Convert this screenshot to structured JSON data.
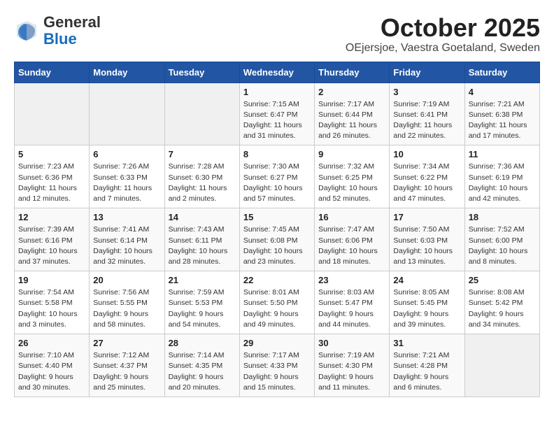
{
  "header": {
    "logo_general": "General",
    "logo_blue": "Blue",
    "month": "October 2025",
    "location": "OEjersjoe, Vaestra Goetaland, Sweden"
  },
  "days_of_week": [
    "Sunday",
    "Monday",
    "Tuesday",
    "Wednesday",
    "Thursday",
    "Friday",
    "Saturday"
  ],
  "weeks": [
    [
      {
        "day": "",
        "info": ""
      },
      {
        "day": "",
        "info": ""
      },
      {
        "day": "",
        "info": ""
      },
      {
        "day": "1",
        "info": "Sunrise: 7:15 AM\nSunset: 6:47 PM\nDaylight: 11 hours\nand 31 minutes."
      },
      {
        "day": "2",
        "info": "Sunrise: 7:17 AM\nSunset: 6:44 PM\nDaylight: 11 hours\nand 26 minutes."
      },
      {
        "day": "3",
        "info": "Sunrise: 7:19 AM\nSunset: 6:41 PM\nDaylight: 11 hours\nand 22 minutes."
      },
      {
        "day": "4",
        "info": "Sunrise: 7:21 AM\nSunset: 6:38 PM\nDaylight: 11 hours\nand 17 minutes."
      }
    ],
    [
      {
        "day": "5",
        "info": "Sunrise: 7:23 AM\nSunset: 6:36 PM\nDaylight: 11 hours\nand 12 minutes."
      },
      {
        "day": "6",
        "info": "Sunrise: 7:26 AM\nSunset: 6:33 PM\nDaylight: 11 hours\nand 7 minutes."
      },
      {
        "day": "7",
        "info": "Sunrise: 7:28 AM\nSunset: 6:30 PM\nDaylight: 11 hours\nand 2 minutes."
      },
      {
        "day": "8",
        "info": "Sunrise: 7:30 AM\nSunset: 6:27 PM\nDaylight: 10 hours\nand 57 minutes."
      },
      {
        "day": "9",
        "info": "Sunrise: 7:32 AM\nSunset: 6:25 PM\nDaylight: 10 hours\nand 52 minutes."
      },
      {
        "day": "10",
        "info": "Sunrise: 7:34 AM\nSunset: 6:22 PM\nDaylight: 10 hours\nand 47 minutes."
      },
      {
        "day": "11",
        "info": "Sunrise: 7:36 AM\nSunset: 6:19 PM\nDaylight: 10 hours\nand 42 minutes."
      }
    ],
    [
      {
        "day": "12",
        "info": "Sunrise: 7:39 AM\nSunset: 6:16 PM\nDaylight: 10 hours\nand 37 minutes."
      },
      {
        "day": "13",
        "info": "Sunrise: 7:41 AM\nSunset: 6:14 PM\nDaylight: 10 hours\nand 32 minutes."
      },
      {
        "day": "14",
        "info": "Sunrise: 7:43 AM\nSunset: 6:11 PM\nDaylight: 10 hours\nand 28 minutes."
      },
      {
        "day": "15",
        "info": "Sunrise: 7:45 AM\nSunset: 6:08 PM\nDaylight: 10 hours\nand 23 minutes."
      },
      {
        "day": "16",
        "info": "Sunrise: 7:47 AM\nSunset: 6:06 PM\nDaylight: 10 hours\nand 18 minutes."
      },
      {
        "day": "17",
        "info": "Sunrise: 7:50 AM\nSunset: 6:03 PM\nDaylight: 10 hours\nand 13 minutes."
      },
      {
        "day": "18",
        "info": "Sunrise: 7:52 AM\nSunset: 6:00 PM\nDaylight: 10 hours\nand 8 minutes."
      }
    ],
    [
      {
        "day": "19",
        "info": "Sunrise: 7:54 AM\nSunset: 5:58 PM\nDaylight: 10 hours\nand 3 minutes."
      },
      {
        "day": "20",
        "info": "Sunrise: 7:56 AM\nSunset: 5:55 PM\nDaylight: 9 hours\nand 58 minutes."
      },
      {
        "day": "21",
        "info": "Sunrise: 7:59 AM\nSunset: 5:53 PM\nDaylight: 9 hours\nand 54 minutes."
      },
      {
        "day": "22",
        "info": "Sunrise: 8:01 AM\nSunset: 5:50 PM\nDaylight: 9 hours\nand 49 minutes."
      },
      {
        "day": "23",
        "info": "Sunrise: 8:03 AM\nSunset: 5:47 PM\nDaylight: 9 hours\nand 44 minutes."
      },
      {
        "day": "24",
        "info": "Sunrise: 8:05 AM\nSunset: 5:45 PM\nDaylight: 9 hours\nand 39 minutes."
      },
      {
        "day": "25",
        "info": "Sunrise: 8:08 AM\nSunset: 5:42 PM\nDaylight: 9 hours\nand 34 minutes."
      }
    ],
    [
      {
        "day": "26",
        "info": "Sunrise: 7:10 AM\nSunset: 4:40 PM\nDaylight: 9 hours\nand 30 minutes."
      },
      {
        "day": "27",
        "info": "Sunrise: 7:12 AM\nSunset: 4:37 PM\nDaylight: 9 hours\nand 25 minutes."
      },
      {
        "day": "28",
        "info": "Sunrise: 7:14 AM\nSunset: 4:35 PM\nDaylight: 9 hours\nand 20 minutes."
      },
      {
        "day": "29",
        "info": "Sunrise: 7:17 AM\nSunset: 4:33 PM\nDaylight: 9 hours\nand 15 minutes."
      },
      {
        "day": "30",
        "info": "Sunrise: 7:19 AM\nSunset: 4:30 PM\nDaylight: 9 hours\nand 11 minutes."
      },
      {
        "day": "31",
        "info": "Sunrise: 7:21 AM\nSunset: 4:28 PM\nDaylight: 9 hours\nand 6 minutes."
      },
      {
        "day": "",
        "info": ""
      }
    ]
  ]
}
